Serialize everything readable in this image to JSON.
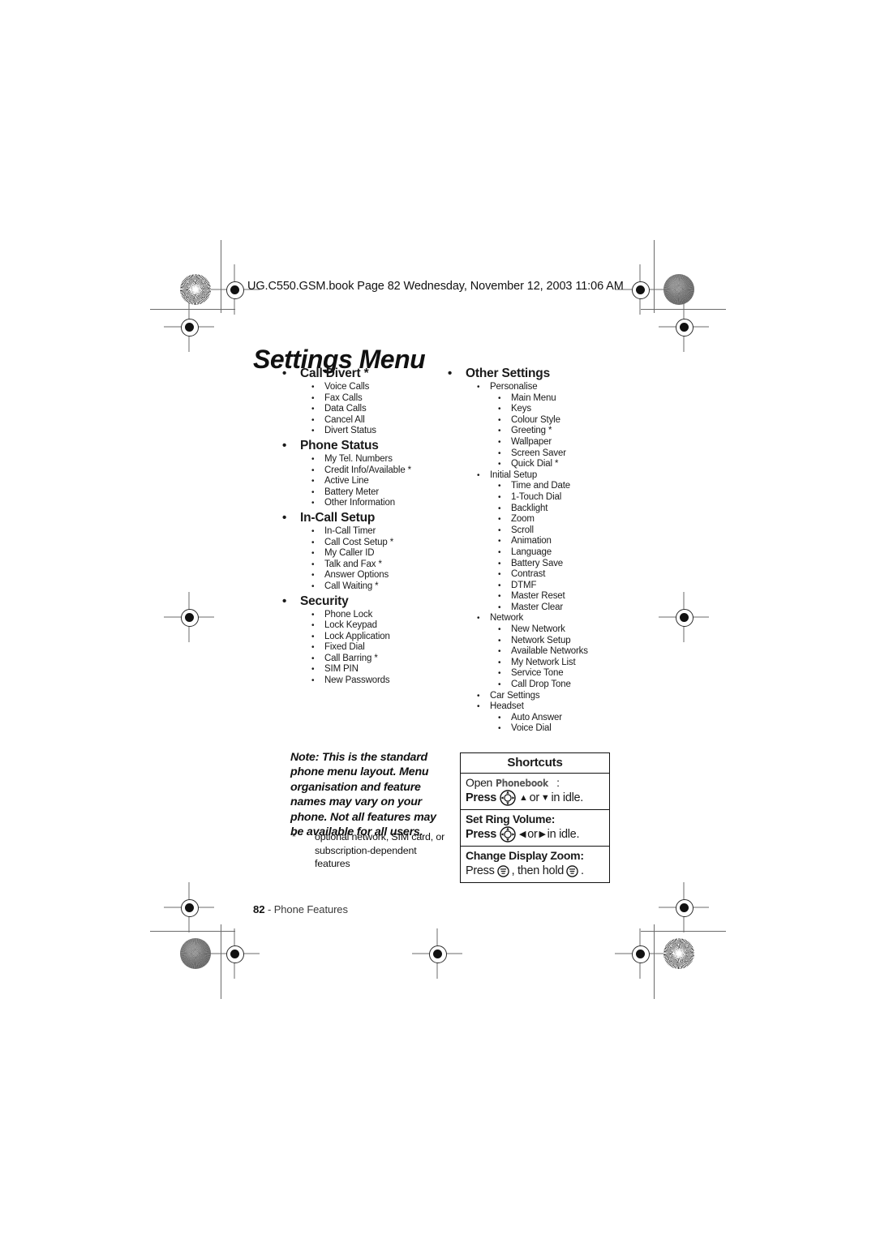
{
  "header": {
    "book_line": "UG.C550.GSM.book  Page 82  Wednesday, November 12, 2003  11:06 AM"
  },
  "page_title": "Settings Menu",
  "menu_columns": {
    "left": [
      {
        "label": "Call Divert *",
        "children": [
          {
            "label": "Voice Calls"
          },
          {
            "label": "Fax Calls"
          },
          {
            "label": "Data Calls"
          },
          {
            "label": "Cancel All"
          },
          {
            "label": "Divert Status"
          }
        ]
      },
      {
        "label": "Phone Status",
        "children": [
          {
            "label": "My Tel. Numbers"
          },
          {
            "label": "Credit Info/Available *"
          },
          {
            "label": "Active Line"
          },
          {
            "label": "Battery Meter"
          },
          {
            "label": "Other Information"
          }
        ]
      },
      {
        "label": "In-Call Setup",
        "children": [
          {
            "label": "In-Call Timer"
          },
          {
            "label": "Call Cost Setup *"
          },
          {
            "label": "My Caller ID"
          },
          {
            "label": "Talk and Fax *"
          },
          {
            "label": "Answer Options"
          },
          {
            "label": "Call Waiting *"
          }
        ]
      },
      {
        "label": "Security",
        "children": [
          {
            "label": "Phone Lock"
          },
          {
            "label": "Lock Keypad"
          },
          {
            "label": "Lock Application"
          },
          {
            "label": "Fixed Dial"
          },
          {
            "label": "Call Barring *"
          },
          {
            "label": "SIM PIN"
          },
          {
            "label": "New Passwords"
          }
        ]
      }
    ],
    "right": [
      {
        "label": "Other Settings",
        "children": [
          {
            "label": "Personalise",
            "children": [
              {
                "label": "Main Menu"
              },
              {
                "label": "Keys"
              },
              {
                "label": "Colour Style"
              },
              {
                "label": "Greeting *"
              },
              {
                "label": "Wallpaper"
              },
              {
                "label": "Screen Saver"
              },
              {
                "label": "Quick Dial *"
              }
            ]
          },
          {
            "label": "Initial Setup",
            "children": [
              {
                "label": "Time and Date"
              },
              {
                "label": "1-Touch Dial"
              },
              {
                "label": "Backlight"
              },
              {
                "label": "Zoom"
              },
              {
                "label": "Scroll"
              },
              {
                "label": "Animation"
              },
              {
                "label": "Language"
              },
              {
                "label": "Battery Save"
              },
              {
                "label": "Contrast"
              },
              {
                "label": "DTMF"
              },
              {
                "label": "Master Reset"
              },
              {
                "label": "Master Clear"
              }
            ]
          },
          {
            "label": "Network",
            "children": [
              {
                "label": "New Network"
              },
              {
                "label": "Network Setup"
              },
              {
                "label": "Available Networks"
              },
              {
                "label": "My Network List"
              },
              {
                "label": "Service Tone"
              },
              {
                "label": "Call Drop Tone"
              }
            ]
          },
          {
            "label": "Car Settings",
            "children": []
          },
          {
            "label": "Headset",
            "children": [
              {
                "label": "Auto Answer"
              },
              {
                "label": "Voice Dial"
              }
            ]
          }
        ]
      }
    ]
  },
  "note": {
    "lead": "Note:",
    "body": " This is the standard phone menu layout. Menu organisation and feature names may vary on your phone. Not all features may be available for all users."
  },
  "footnote": {
    "marker": "*",
    "text": "optional network, SIM card, or subscription-dependent features"
  },
  "folio": {
    "page_number": "82",
    "separator": " - ",
    "section": "Phone Features"
  },
  "shortcuts": {
    "title": "Shortcuts",
    "rows": [
      {
        "label_prefix": "Open ",
        "label_styled": "Phonebook",
        "label_suffix": ":",
        "action_press": "Press",
        "icon": "nav-key-icon",
        "action_mid_1": "▲",
        "action_or": " or ",
        "action_mid_2": "▼",
        "action_tail": " in idle."
      },
      {
        "label_prefix": "Set Ring Volume",
        "label_styled": "",
        "label_suffix": ":",
        "action_press": "Press",
        "icon": "nav-key-icon",
        "action_mid_1": "◀",
        "action_or": " or ",
        "action_mid_2": "▶",
        "action_tail": " in idle."
      },
      {
        "label_prefix": "Change Display Zoom",
        "label_styled": "",
        "label_suffix": ":",
        "action_press": "Press",
        "icon": "menu-key-icon",
        "action_mid_1": "",
        "action_or": ", then hold ",
        "action_mid_2": "",
        "action_tail": "."
      }
    ]
  },
  "colors": {
    "ink": "#111111",
    "mark_gray": "#6b6b6b",
    "display_font_gray": "#555555"
  }
}
